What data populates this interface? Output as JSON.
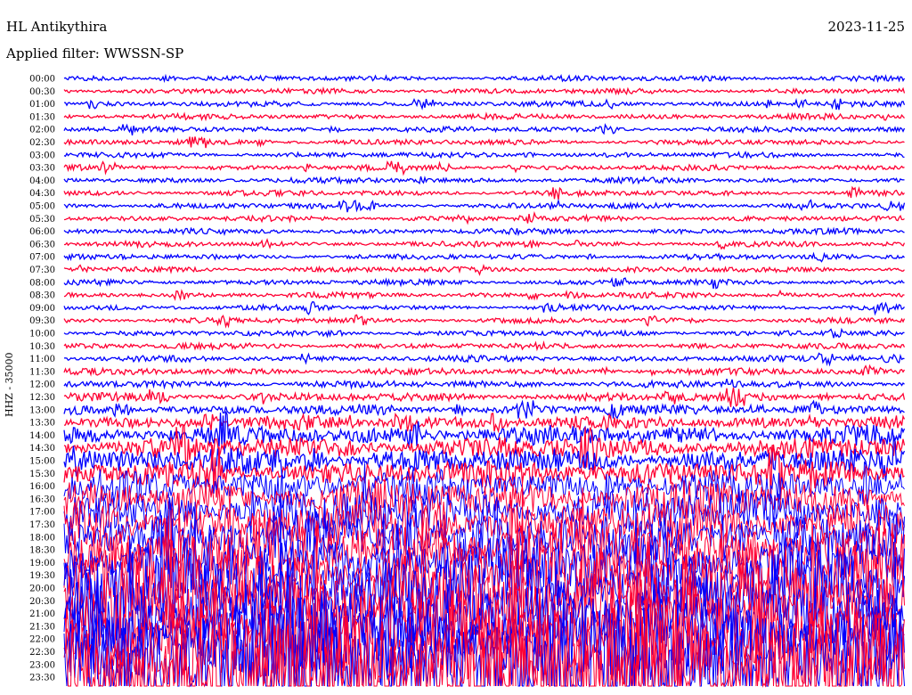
{
  "header": {
    "station": "HL Antikythira",
    "date": "2023-11-25",
    "filter_prefix": "Applied filter:",
    "filter": "WWSSN-SP"
  },
  "channel": {
    "label": "HHZ - 35000"
  },
  "chart_data": {
    "type": "line",
    "description_kind": "helicorder",
    "time_labels": [
      "00:00",
      "00:30",
      "01:00",
      "01:30",
      "02:00",
      "02:30",
      "03:00",
      "03:30",
      "04:00",
      "04:30",
      "05:00",
      "05:30",
      "06:00",
      "06:30",
      "07:00",
      "07:30",
      "08:00",
      "08:30",
      "09:00",
      "09:30",
      "10:00",
      "10:30",
      "11:00",
      "11:30",
      "12:00",
      "12:30",
      "13:00",
      "13:30",
      "14:00",
      "14:30",
      "15:00",
      "15:30",
      "16:00",
      "16:30",
      "17:00",
      "17:30",
      "18:00",
      "18:30",
      "19:00",
      "19:30",
      "20:00",
      "20:30",
      "21:00",
      "21:30",
      "22:00",
      "22:30",
      "23:00",
      "23:30"
    ],
    "trace_colors": [
      "#0000ff",
      "#ff0033"
    ],
    "relative_amplitude": [
      1,
      1,
      1,
      1,
      1,
      1,
      1,
      1,
      1,
      1,
      1,
      1,
      1,
      1,
      1,
      1,
      1,
      1,
      1,
      1,
      1,
      1.1,
      1.1,
      1.2,
      1.3,
      1.5,
      1.8,
      2.5,
      3.5,
      4,
      4.5,
      5,
      6,
      7,
      8,
      9,
      10,
      11,
      12,
      13,
      14,
      14,
      15,
      15,
      16,
      18,
      25,
      30
    ],
    "grid": false
  }
}
